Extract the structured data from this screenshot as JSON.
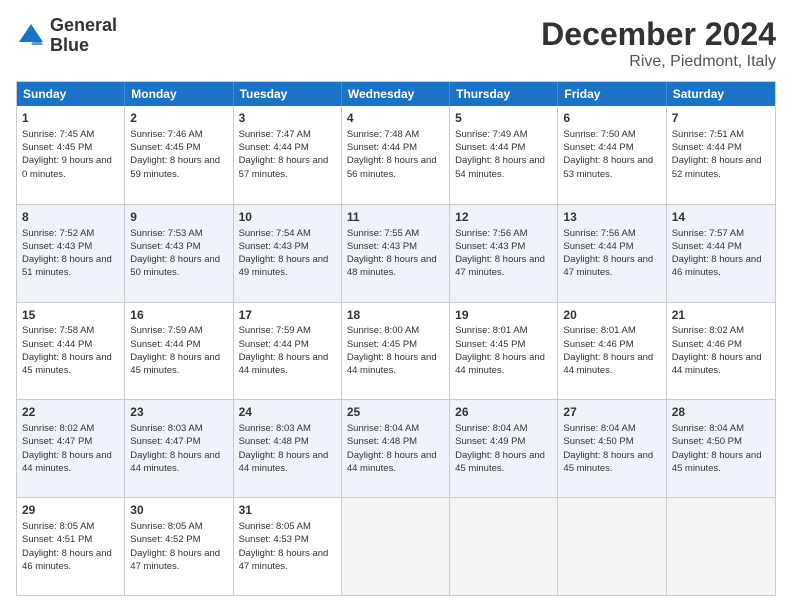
{
  "logo": {
    "line1": "General",
    "line2": "Blue"
  },
  "title": "December 2024",
  "subtitle": "Rive, Piedmont, Italy",
  "days": [
    "Sunday",
    "Monday",
    "Tuesday",
    "Wednesday",
    "Thursday",
    "Friday",
    "Saturday"
  ],
  "rows": [
    [
      {
        "num": "1",
        "rise": "7:45 AM",
        "set": "4:45 PM",
        "daylight": "9 hours and 0 minutes."
      },
      {
        "num": "2",
        "rise": "7:46 AM",
        "set": "4:45 PM",
        "daylight": "8 hours and 59 minutes."
      },
      {
        "num": "3",
        "rise": "7:47 AM",
        "set": "4:44 PM",
        "daylight": "8 hours and 57 minutes."
      },
      {
        "num": "4",
        "rise": "7:48 AM",
        "set": "4:44 PM",
        "daylight": "8 hours and 56 minutes."
      },
      {
        "num": "5",
        "rise": "7:49 AM",
        "set": "4:44 PM",
        "daylight": "8 hours and 54 minutes."
      },
      {
        "num": "6",
        "rise": "7:50 AM",
        "set": "4:44 PM",
        "daylight": "8 hours and 53 minutes."
      },
      {
        "num": "7",
        "rise": "7:51 AM",
        "set": "4:44 PM",
        "daylight": "8 hours and 52 minutes."
      }
    ],
    [
      {
        "num": "8",
        "rise": "7:52 AM",
        "set": "4:43 PM",
        "daylight": "8 hours and 51 minutes."
      },
      {
        "num": "9",
        "rise": "7:53 AM",
        "set": "4:43 PM",
        "daylight": "8 hours and 50 minutes."
      },
      {
        "num": "10",
        "rise": "7:54 AM",
        "set": "4:43 PM",
        "daylight": "8 hours and 49 minutes."
      },
      {
        "num": "11",
        "rise": "7:55 AM",
        "set": "4:43 PM",
        "daylight": "8 hours and 48 minutes."
      },
      {
        "num": "12",
        "rise": "7:56 AM",
        "set": "4:43 PM",
        "daylight": "8 hours and 47 minutes."
      },
      {
        "num": "13",
        "rise": "7:56 AM",
        "set": "4:44 PM",
        "daylight": "8 hours and 47 minutes."
      },
      {
        "num": "14",
        "rise": "7:57 AM",
        "set": "4:44 PM",
        "daylight": "8 hours and 46 minutes."
      }
    ],
    [
      {
        "num": "15",
        "rise": "7:58 AM",
        "set": "4:44 PM",
        "daylight": "8 hours and 45 minutes."
      },
      {
        "num": "16",
        "rise": "7:59 AM",
        "set": "4:44 PM",
        "daylight": "8 hours and 45 minutes."
      },
      {
        "num": "17",
        "rise": "7:59 AM",
        "set": "4:44 PM",
        "daylight": "8 hours and 44 minutes."
      },
      {
        "num": "18",
        "rise": "8:00 AM",
        "set": "4:45 PM",
        "daylight": "8 hours and 44 minutes."
      },
      {
        "num": "19",
        "rise": "8:01 AM",
        "set": "4:45 PM",
        "daylight": "8 hours and 44 minutes."
      },
      {
        "num": "20",
        "rise": "8:01 AM",
        "set": "4:46 PM",
        "daylight": "8 hours and 44 minutes."
      },
      {
        "num": "21",
        "rise": "8:02 AM",
        "set": "4:46 PM",
        "daylight": "8 hours and 44 minutes."
      }
    ],
    [
      {
        "num": "22",
        "rise": "8:02 AM",
        "set": "4:47 PM",
        "daylight": "8 hours and 44 minutes."
      },
      {
        "num": "23",
        "rise": "8:03 AM",
        "set": "4:47 PM",
        "daylight": "8 hours and 44 minutes."
      },
      {
        "num": "24",
        "rise": "8:03 AM",
        "set": "4:48 PM",
        "daylight": "8 hours and 44 minutes."
      },
      {
        "num": "25",
        "rise": "8:04 AM",
        "set": "4:48 PM",
        "daylight": "8 hours and 44 minutes."
      },
      {
        "num": "26",
        "rise": "8:04 AM",
        "set": "4:49 PM",
        "daylight": "8 hours and 45 minutes."
      },
      {
        "num": "27",
        "rise": "8:04 AM",
        "set": "4:50 PM",
        "daylight": "8 hours and 45 minutes."
      },
      {
        "num": "28",
        "rise": "8:04 AM",
        "set": "4:50 PM",
        "daylight": "8 hours and 45 minutes."
      }
    ],
    [
      {
        "num": "29",
        "rise": "8:05 AM",
        "set": "4:51 PM",
        "daylight": "8 hours and 46 minutes."
      },
      {
        "num": "30",
        "rise": "8:05 AM",
        "set": "4:52 PM",
        "daylight": "8 hours and 47 minutes."
      },
      {
        "num": "31",
        "rise": "8:05 AM",
        "set": "4:53 PM",
        "daylight": "8 hours and 47 minutes."
      },
      null,
      null,
      null,
      null
    ]
  ],
  "labels": {
    "sunrise": "Sunrise:",
    "sunset": "Sunset:",
    "daylight": "Daylight:"
  }
}
